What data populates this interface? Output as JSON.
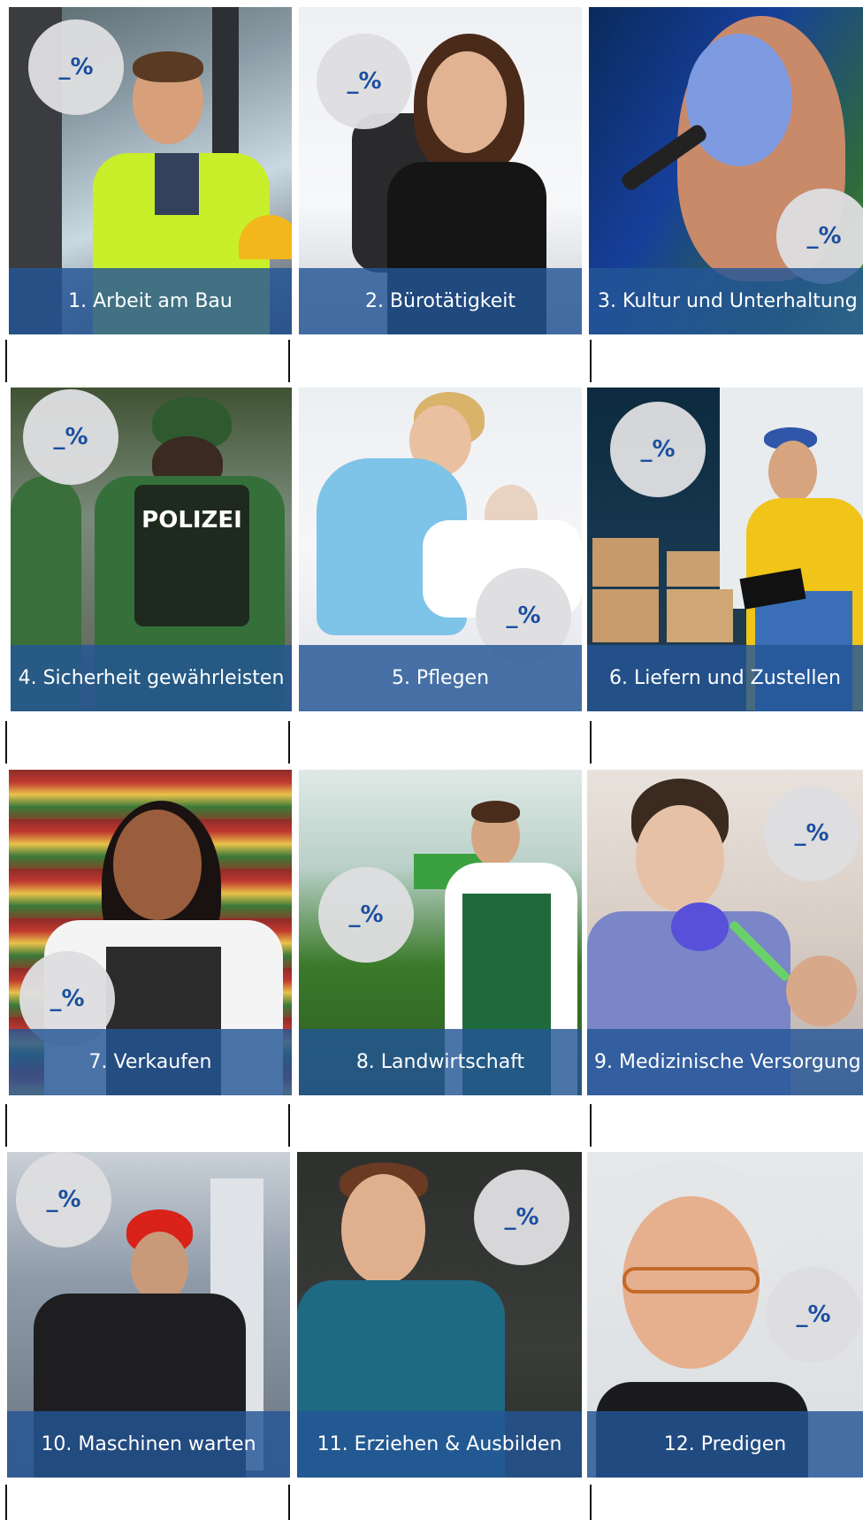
{
  "tiles": [
    {
      "label": "1. Arbeit am Bau",
      "percent": "_%"
    },
    {
      "label": "2. Bürotätigkeit",
      "percent": "_%"
    },
    {
      "label": "3. Kultur und Unterhaltung",
      "percent": "_%"
    },
    {
      "label": "4. Sicherheit gewährleisten",
      "percent": "_%",
      "badge_text": "POLIZEI"
    },
    {
      "label": "5. Pflegen",
      "percent": "_%"
    },
    {
      "label": "6. Liefern und Zustellen",
      "percent": "_%"
    },
    {
      "label": "7. Verkaufen",
      "percent": "_%"
    },
    {
      "label": "8. Landwirtschaft",
      "percent": "_%"
    },
    {
      "label": "9. Medizinische Versorgung",
      "percent": "_%"
    },
    {
      "label": "10. Maschinen warten",
      "percent": "_%"
    },
    {
      "label": "11. Erziehen & Ausbilden",
      "percent": "_%"
    },
    {
      "label": "12. Predigen",
      "percent": "_%"
    }
  ],
  "colors": {
    "caption_overlay": "#2355a0",
    "percent_text": "#1b4fa0",
    "percent_circle": "#dedee0"
  }
}
